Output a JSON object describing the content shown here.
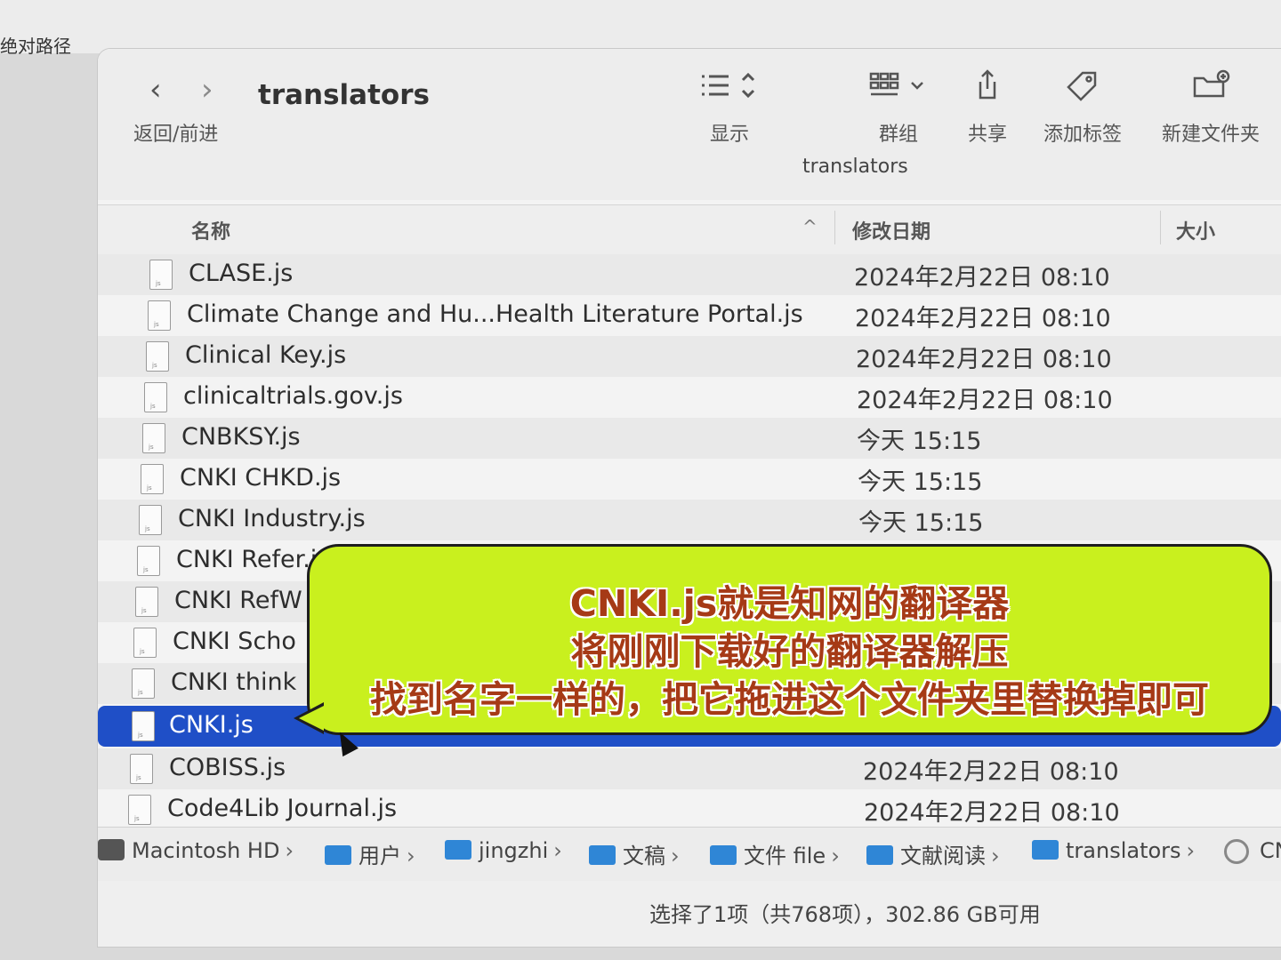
{
  "background": {
    "title_fragment": "绝对路径"
  },
  "toolbar": {
    "back_arrow": "‹",
    "forward_arrow": "›",
    "nav_label": "返回/前进",
    "title": "translators",
    "view_label": "显示",
    "group_label": "群组",
    "share_label": "共享",
    "tags_label": "添加标签",
    "new_folder_label": "新建文件夹",
    "path_title": "translators"
  },
  "columns": {
    "name": "名称",
    "modified": "修改日期",
    "size": "大小",
    "sort_indicator": "^"
  },
  "files": [
    {
      "name": "CLASE.js",
      "date": "2024年2月22日 08:10"
    },
    {
      "name": "Climate Change and Hu...Health Literature Portal.js",
      "date": "2024年2月22日 08:10"
    },
    {
      "name": "Clinical Key.js",
      "date": "2024年2月22日 08:10"
    },
    {
      "name": "clinicaltrials.gov.js",
      "date": "2024年2月22日 08:10"
    },
    {
      "name": "CNBKSY.js",
      "date": "今天 15:15"
    },
    {
      "name": "CNKI CHKD.js",
      "date": "今天 15:15"
    },
    {
      "name": "CNKI Industry.js",
      "date": "今天 15:15"
    },
    {
      "name": "CNKI Refer.js",
      "date": ""
    },
    {
      "name": "CNKI RefW",
      "date": ""
    },
    {
      "name": "CNKI Scho",
      "date": ""
    },
    {
      "name": "CNKI think",
      "date": ""
    },
    {
      "name": "CNKI.js",
      "date": "",
      "selected": true
    },
    {
      "name": "COBISS.js",
      "date": "2024年2月22日 08:10"
    },
    {
      "name": "Code4Lib Journal.js",
      "date": "2024年2月22日 08:10"
    }
  ],
  "pathbar": {
    "items": [
      "Macintosh HD",
      "用户",
      "jingzhi",
      "文稿",
      "文件 file",
      "文献阅读",
      "translators",
      "CN"
    ],
    "separator": "›"
  },
  "status": {
    "text": "选择了1项（共768项），302.86 GB可用"
  },
  "callout": {
    "line1": "CNKI.js就是知网的翻译器",
    "line2": "将刚刚下载好的翻译器解压",
    "line3": "找到名字一样的，把它拖进这个文件夹里替换掉即可"
  },
  "colors": {
    "selection": "#1f4fc7",
    "callout_bg": "#c9f01e",
    "callout_text": "#a63a16"
  }
}
